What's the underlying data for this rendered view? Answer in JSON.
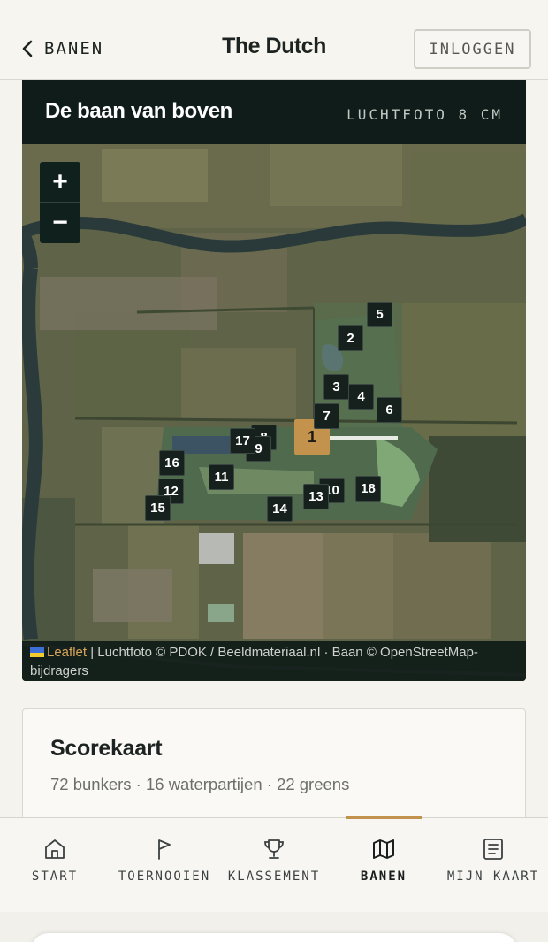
{
  "header": {
    "back_label": "BANEN",
    "title": "The Dutch",
    "login_label": "INLOGGEN"
  },
  "map": {
    "title": "De baan van boven",
    "meta": "LUCHTFOTO 8 CM",
    "zoom_in": "+",
    "zoom_out": "−",
    "holes": [
      "1",
      "2",
      "3",
      "4",
      "5",
      "6",
      "7",
      "8",
      "9",
      "10",
      "11",
      "12",
      "13",
      "14",
      "15",
      "16",
      "17",
      "18"
    ],
    "active_hole": "1",
    "attribution": {
      "leaflet": "Leaflet",
      "rest": " | Luchtfoto © PDOK / Beeldmateriaal.nl · Baan © OpenStreetMap-bijdragers"
    }
  },
  "scorecard": {
    "title": "Scorekaart",
    "stats": "72 bunkers · 16 waterpartijen · 22 greens"
  },
  "nav": {
    "items": [
      {
        "label": "START",
        "icon": "home-icon"
      },
      {
        "label": "TOERNOOIEN",
        "icon": "flag-icon"
      },
      {
        "label": "KLASSEMENT",
        "icon": "trophy-icon"
      },
      {
        "label": "BANEN",
        "icon": "map-icon"
      },
      {
        "label": "MIJN KAART",
        "icon": "scorecard-icon"
      }
    ],
    "active": "BANEN"
  },
  "colors": {
    "accent": "#c3924c",
    "dark_panel": "#0f1c19",
    "background": "#f4f3ee"
  }
}
